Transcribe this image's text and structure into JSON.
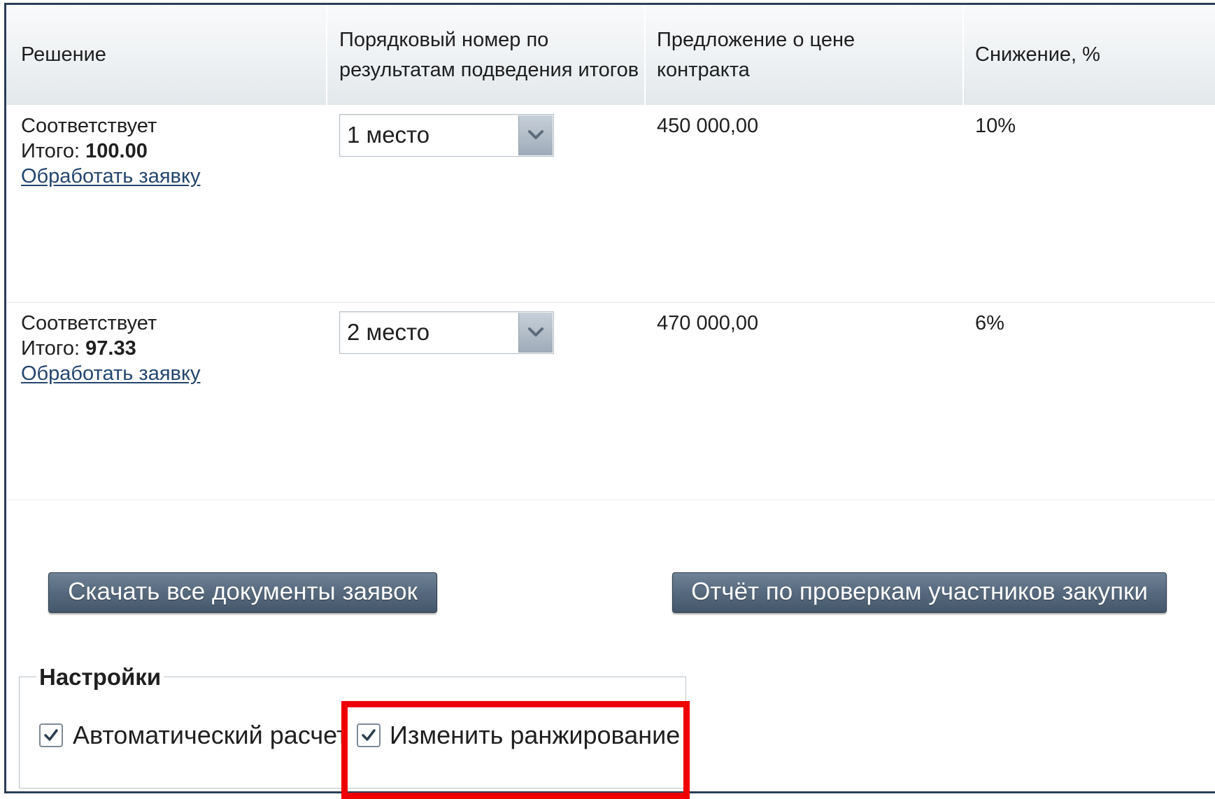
{
  "table": {
    "headers": [
      "Решение",
      "Порядковый номер по результатам подведения итогов",
      "Предложение о цене контракта",
      "Снижение, %"
    ],
    "rows": [
      {
        "decision": "Соответствует",
        "total_label": "Итого:",
        "total_value": "100.00",
        "process_link": "Обработать заявку",
        "rank": "1 место",
        "price": "450 000,00",
        "reduction": "10%"
      },
      {
        "decision": "Соответствует",
        "total_label": "Итого:",
        "total_value": "97.33",
        "process_link": "Обработать заявку",
        "rank": "2 место",
        "price": "470 000,00",
        "reduction": "6%"
      }
    ]
  },
  "buttons": {
    "download_all": "Скачать все документы заявок",
    "report": "Отчёт по проверкам участников закупки"
  },
  "settings": {
    "legend": "Настройки",
    "auto_calc": {
      "label": "Автоматический расчет",
      "checked": true
    },
    "change_ranking": {
      "label": "Изменить ранжирование",
      "checked": true
    }
  },
  "colors": {
    "highlight": "#ee0000",
    "link": "#24466f",
    "button": "#56697e"
  }
}
